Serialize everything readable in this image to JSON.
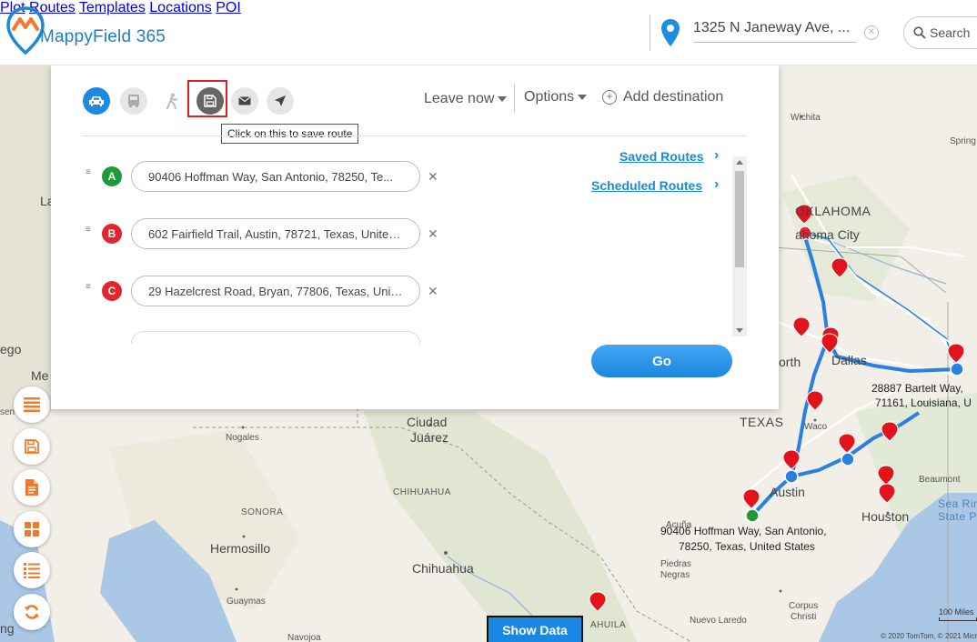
{
  "app": {
    "name": "MappyField 365"
  },
  "nav": [
    {
      "label": "Plot"
    },
    {
      "label": "Routes"
    },
    {
      "label": "Templates"
    },
    {
      "label": "Locations"
    },
    {
      "label": "POI"
    }
  ],
  "location_search": {
    "value": "1325 N Janeway Ave, ..."
  },
  "search": {
    "placeholder": "Search"
  },
  "panel": {
    "tooltip": "Click on this to save route",
    "leave_now": "Leave now",
    "options": "Options",
    "add_destination": "Add destination",
    "saved_routes": "Saved Routes",
    "scheduled_routes": "Scheduled Routes",
    "go_label": "Go",
    "stops": [
      {
        "letter": "A",
        "color": "#1f9a37",
        "address": "90406 Hoffman Way, San Antonio, 78250, Te..."
      },
      {
        "letter": "B",
        "color": "#e0262e",
        "address": "602 Fairfield Trail, Austin, 78721, Texas, United..."
      },
      {
        "letter": "C",
        "color": "#e0262e",
        "address": "29 Hazelcrest Road, Bryan, 77806, Texas, Unit..."
      }
    ]
  },
  "map": {
    "labels": {
      "wichita": "Wichita",
      "oklahoma": "OKLAHOMA",
      "okc": "ahoma City",
      "worth": "orth",
      "dallas": "Dallas",
      "waco": "Waco",
      "texas": "TEXAS",
      "austin": "Austin",
      "houston": "Houston",
      "beaumont": "Beaumont",
      "sea_rim": "Sea Rim",
      "state_park": "State Pa",
      "ciudad": "Ciudad",
      "juarez": "Juárez",
      "nogales": "Nogales",
      "chihuahua_state": "CHIHUAHUA",
      "sonora": "SONORA",
      "hermosillo": "Hermosillo",
      "chihuahua": "Chihuahua",
      "guaymas": "Guaymas",
      "piedras": "Piedras",
      "negras": "Negras",
      "acuna": "Acuña",
      "nuevo_laredo": "Nuevo Laredo",
      "corpus": "Corpus",
      "christi": "Christi",
      "navojoa": "Navojoa",
      "coahuila": "AHUILA",
      "springfield": "Spring",
      "ego": "ego",
      "me": "Me",
      "la": "La",
      "sen": "sen",
      "ng": "ng",
      "shreveport_addr1": "28887 Bartelt Way,",
      "shreveport_addr2": "71161, Louisiana, U",
      "sa_addr1": "90406 Hoffman Way, San Antonio,",
      "sa_addr2": "78250, Texas, United States"
    },
    "scale": "100 Miles",
    "credits": "© 2020 TomTom, © 2021 Micr"
  },
  "show_data": "Show Data",
  "colors": {
    "accent": "#1a87e2",
    "route": "#2b7fe0",
    "marker": "#e3131b",
    "save_highlight": "#e32020"
  }
}
